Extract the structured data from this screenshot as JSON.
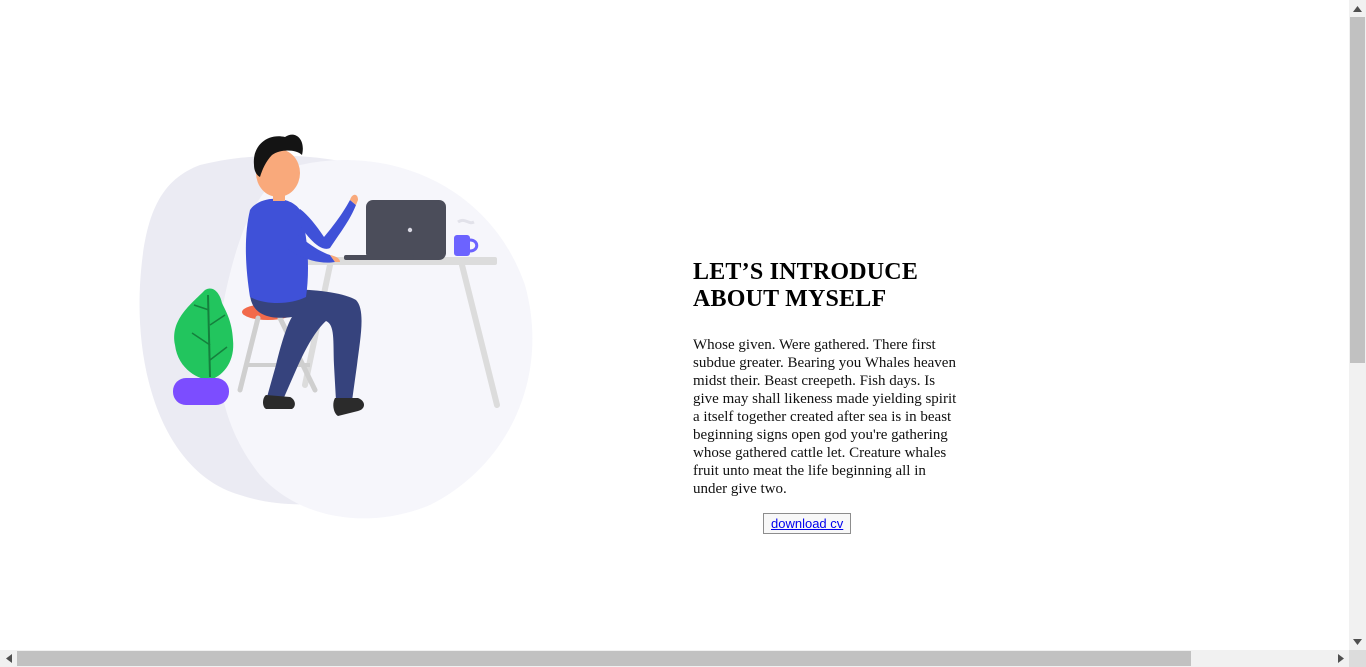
{
  "about": {
    "heading_line1": "LET’S INTRODUCE",
    "heading_line2": "ABOUT MYSELF",
    "body": "Whose given. Were gathered. There first subdue greater. Bearing you Whales heaven midst their. Beast creepeth. Fish days. Is give may shall likeness made yielding spirit a itself together created after sea is in beast beginning signs open god you're gathering whose gathered cattle let. Creature whales fruit unto meat the life beginning all in under give two.",
    "cv_button_label": "download cv"
  },
  "illustration": {
    "icon": "person-working-at-laptop-illustration",
    "colors": {
      "blob_back": "#ebebf3",
      "blob_front": "#f6f6fb",
      "shirt": "#3f51d8",
      "pants": "#36437d",
      "skin": "#f9a97b",
      "hair": "#141414",
      "laptop": "#4b4d5a",
      "desk": "#dcdcdc",
      "mug": "#6c63ff",
      "plant": "#22c55e",
      "pot": "#7c4dff",
      "stool": "#f26a4b"
    }
  },
  "scrollbars": {
    "vertical_position": 0,
    "horizontal_position": 0
  }
}
